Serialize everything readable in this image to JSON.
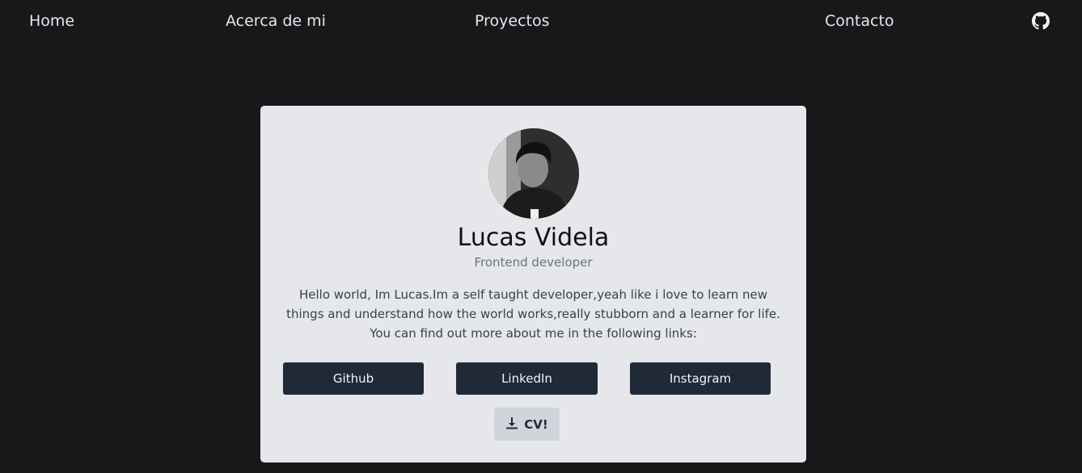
{
  "nav": {
    "links": [
      {
        "label": "Home"
      },
      {
        "label": "Acerca de mi"
      },
      {
        "label": "Proyectos"
      },
      {
        "label": "Contacto"
      }
    ],
    "github_icon": "github-icon"
  },
  "profile": {
    "avatar_icon": "profile-photo",
    "name": "Lucas Videla",
    "role": "Frontend developer",
    "bio_lines": [
      "Hello world, Im Lucas.Im a self taught developer,yeah like i love to learn new",
      "things and understand how the world works,really stubborn and a learner for life.",
      "You can find out more about me in the following links:"
    ],
    "links": [
      {
        "label": "Github"
      },
      {
        "label": "LinkedIn"
      },
      {
        "label": "Instagram"
      }
    ],
    "cv_button": {
      "label": "CV!",
      "icon": "download-icon"
    }
  },
  "colors": {
    "page_bg": "#18181b",
    "card_bg": "#e5e7eb",
    "button_bg": "#1f2937",
    "cv_button_bg": "#d1d5db"
  }
}
